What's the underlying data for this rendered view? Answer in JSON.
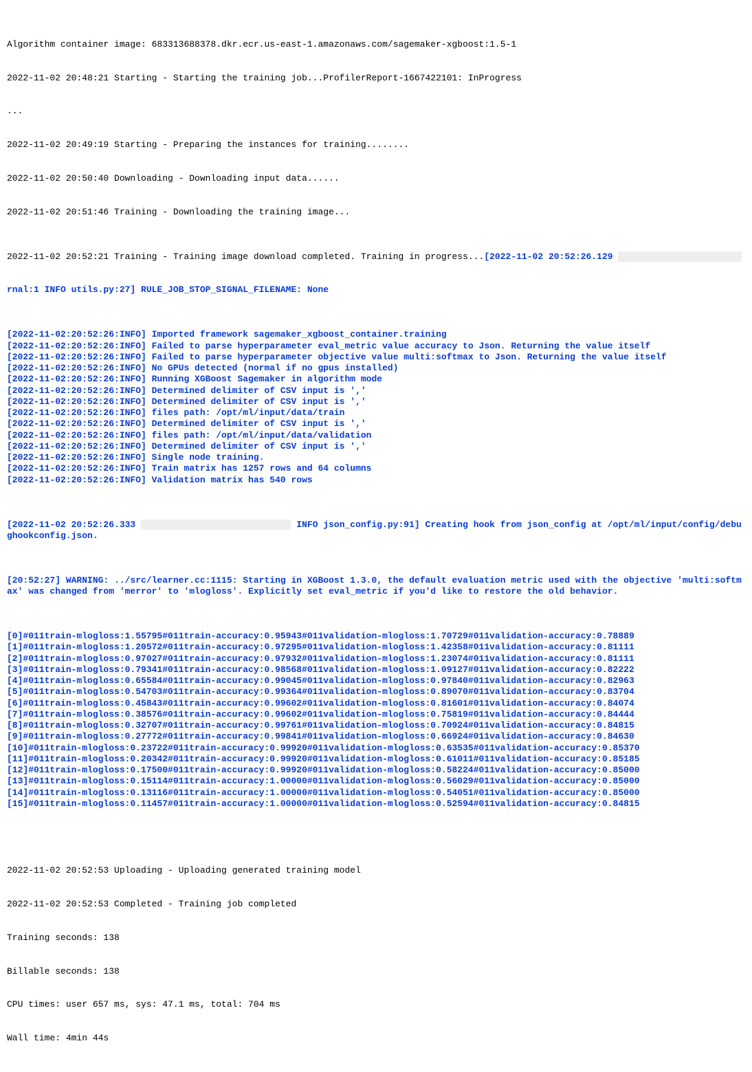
{
  "colors": {
    "log_blue": "#0a3dd2",
    "highlight_bg": "#eeeeee"
  },
  "intro": {
    "image": "Algorithm container image: 683313688378.dkr.ecr.us-east-1.amazonaws.com/sagemaker-xgboost:1.5-1",
    "start": "2022-11-02 20:48:21 Starting - Starting the training job...ProfilerReport-1667422101: InProgress",
    "dots": "...",
    "prep": "2022-11-02 20:49:19 Starting - Preparing the instances for training........",
    "download": "2022-11-02 20:50:40 Downloading - Downloading input data......",
    "trainimg": "2022-11-02 20:51:46 Training - Downloading the training image...",
    "training": "2022-11-02 20:52:21 Training - Training image download completed. Training in progress..."
  },
  "log_head": {
    "pre_ip": "[2022-11-02 20:52:26.129 ",
    "ip": "                       ",
    "post_ip": "rnal:1 INFO utils.py:27] RULE_JOB_STOP_SIGNAL_FILENAME: None"
  },
  "info_lines": [
    "[2022-11-02:20:52:26:INFO] Imported framework sagemaker_xgboost_container.training",
    "[2022-11-02:20:52:26:INFO] Failed to parse hyperparameter eval_metric value accuracy to Json. Returning the value itself",
    "[2022-11-02:20:52:26:INFO] Failed to parse hyperparameter objective value multi:softmax to Json. Returning the value itself",
    "[2022-11-02:20:52:26:INFO] No GPUs detected (normal if no gpus installed)",
    "[2022-11-02:20:52:26:INFO] Running XGBoost Sagemaker in algorithm mode",
    "[2022-11-02:20:52:26:INFO] Determined delimiter of CSV input is ','",
    "[2022-11-02:20:52:26:INFO] Determined delimiter of CSV input is ','",
    "[2022-11-02:20:52:26:INFO] files path: /opt/ml/input/data/train",
    "[2022-11-02:20:52:26:INFO] Determined delimiter of CSV input is ','",
    "[2022-11-02:20:52:26:INFO] files path: /opt/ml/input/data/validation",
    "[2022-11-02:20:52:26:INFO] Determined delimiter of CSV input is ','",
    "[2022-11-02:20:52:26:INFO] Single node training.",
    "[2022-11-02:20:52:26:INFO] Train matrix has 1257 rows and 64 columns",
    "[2022-11-02:20:52:26:INFO] Validation matrix has 540 rows"
  ],
  "hook_line": {
    "pre": "[2022-11-02 20:52:26.333 ",
    "ip": "                            ",
    "post": " INFO json_config.py:91] Creating hook from json_config at /opt/ml/input/config/debughookconfig.json."
  },
  "warning": "[20:52:27] WARNING: ../src/learner.cc:1115: Starting in XGBoost 1.3.0, the default evaluation metric used with the objective 'multi:softmax' was changed from 'merror' to 'mlogloss'. Explicitly set eval_metric if you'd like to restore the old behavior.",
  "metrics": [
    "[0]#011train-mlogloss:1.55795#011train-accuracy:0.95943#011validation-mlogloss:1.70729#011validation-accuracy:0.78889",
    "[1]#011train-mlogloss:1.20572#011train-accuracy:0.97295#011validation-mlogloss:1.42358#011validation-accuracy:0.81111",
    "[2]#011train-mlogloss:0.97027#011train-accuracy:0.97932#011validation-mlogloss:1.23074#011validation-accuracy:0.81111",
    "[3]#011train-mlogloss:0.79341#011train-accuracy:0.98568#011validation-mlogloss:1.09127#011validation-accuracy:0.82222",
    "[4]#011train-mlogloss:0.65584#011train-accuracy:0.99045#011validation-mlogloss:0.97840#011validation-accuracy:0.82963",
    "[5]#011train-mlogloss:0.54703#011train-accuracy:0.99364#011validation-mlogloss:0.89070#011validation-accuracy:0.83704",
    "[6]#011train-mlogloss:0.45843#011train-accuracy:0.99602#011validation-mlogloss:0.81601#011validation-accuracy:0.84074",
    "[7]#011train-mlogloss:0.38576#011train-accuracy:0.99602#011validation-mlogloss:0.75819#011validation-accuracy:0.84444",
    "[8]#011train-mlogloss:0.32707#011train-accuracy:0.99761#011validation-mlogloss:0.70924#011validation-accuracy:0.84815",
    "[9]#011train-mlogloss:0.27772#011train-accuracy:0.99841#011validation-mlogloss:0.66924#011validation-accuracy:0.84630",
    "[10]#011train-mlogloss:0.23722#011train-accuracy:0.99920#011validation-mlogloss:0.63535#011validation-accuracy:0.85370",
    "[11]#011train-mlogloss:0.20342#011train-accuracy:0.99920#011validation-mlogloss:0.61011#011validation-accuracy:0.85185",
    "[12]#011train-mlogloss:0.17500#011train-accuracy:0.99920#011validation-mlogloss:0.58224#011validation-accuracy:0.85000",
    "[13]#011train-mlogloss:0.15114#011train-accuracy:1.00000#011validation-mlogloss:0.56029#011validation-accuracy:0.85000",
    "[14]#011train-mlogloss:0.13116#011train-accuracy:1.00000#011validation-mlogloss:0.54051#011validation-accuracy:0.85000",
    "[15]#011train-mlogloss:0.11457#011train-accuracy:1.00000#011validation-mlogloss:0.52594#011validation-accuracy:0.84815"
  ],
  "tail": {
    "blank": "",
    "upload": "2022-11-02 20:52:53 Uploading - Uploading generated training model",
    "complete": "2022-11-02 20:52:53 Completed - Training job completed",
    "trainsec": "Training seconds: 138",
    "billsec": "Billable seconds: 138",
    "cpu": "CPU times: user 657 ms, sys: 47.1 ms, total: 704 ms",
    "wall": "Wall time: 4min 44s"
  }
}
